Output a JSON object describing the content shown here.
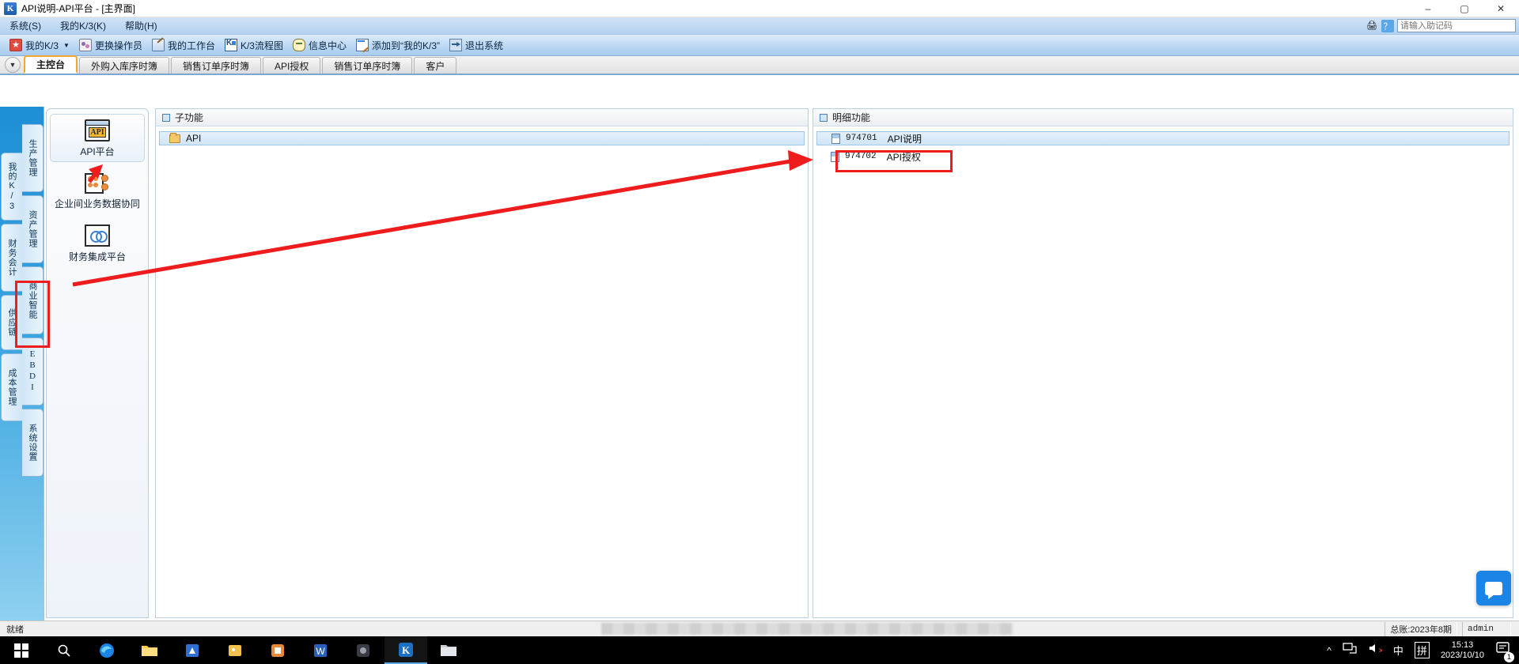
{
  "window": {
    "title": "API说明-API平台 - [主界面]",
    "app_icon": "k3-logo-icon",
    "minimize": "–",
    "maximize": "▢",
    "close": "✕"
  },
  "menubar": {
    "items": [
      {
        "label": "系统(S)",
        "name": "menu-system"
      },
      {
        "label": "我的K/3(K)",
        "name": "menu-my-k3"
      },
      {
        "label": "帮助(H)",
        "name": "menu-help"
      }
    ],
    "help_input_placeholder": "请输入助记码",
    "help_input_value": ""
  },
  "toolbar": {
    "buttons": [
      {
        "label": "我的K/3",
        "icon": "star-icon",
        "has_caret": true
      },
      {
        "label": "更换操作员",
        "icon": "switch-user-icon",
        "has_caret": false
      },
      {
        "label": "我的工作台",
        "icon": "workbench-icon",
        "has_caret": false
      },
      {
        "label": "K/3流程图",
        "icon": "flowchart-icon",
        "has_caret": false
      },
      {
        "label": "信息中心",
        "icon": "message-center-icon",
        "has_caret": false
      },
      {
        "label": "添加到“我的K/3”",
        "icon": "add-note-icon",
        "has_caret": false
      },
      {
        "label": "退出系统",
        "icon": "exit-icon",
        "has_caret": false
      }
    ]
  },
  "tabs": {
    "overflow_icon": "chevron-down-icon",
    "items": [
      {
        "label": "主控台",
        "active": true
      },
      {
        "label": "外购入库序时簿",
        "active": false
      },
      {
        "label": "销售订单序时簿",
        "active": false
      },
      {
        "label": "API授权",
        "active": false
      },
      {
        "label": "销售订单序时簿",
        "active": false
      },
      {
        "label": "客户",
        "active": false
      }
    ]
  },
  "vertical_nav": {
    "left_column": [
      {
        "label": "我的K/3"
      },
      {
        "label": "财务会计"
      },
      {
        "label": "供应链"
      },
      {
        "label": "成本管理"
      }
    ],
    "right_column": [
      {
        "label": "生产管理"
      },
      {
        "label": "资产管理"
      },
      {
        "label": "商业智能"
      },
      {
        "label": "EBDI"
      },
      {
        "label": "系统设置"
      }
    ]
  },
  "module_panel": {
    "items": [
      {
        "label": "API平台",
        "icon": "api-platform-icon",
        "selected": true
      },
      {
        "label": "企业间业务数据协同",
        "icon": "collaboration-icon",
        "selected": false
      },
      {
        "label": "财务集成平台",
        "icon": "finance-integration-icon",
        "selected": false
      }
    ]
  },
  "sub_function_panel": {
    "title": "子功能",
    "header_icon": "panel-square-icon",
    "rows": [
      {
        "label": "API",
        "icon": "folder-icon",
        "selected": true
      }
    ]
  },
  "detail_panel": {
    "title": "明细功能",
    "header_icon": "panel-square-icon",
    "rows": [
      {
        "code": "974701",
        "label": "API说明",
        "icon": "document-icon",
        "selected": true
      },
      {
        "code": "974702",
        "label": "API授权",
        "icon": "document-icon",
        "selected": false
      }
    ]
  },
  "annotations": {
    "color": "#ee1c1c",
    "boxes": [
      {
        "name": "ebdi-nav-highlight"
      },
      {
        "name": "api-authorize-row-highlight"
      }
    ],
    "arrow": {
      "name": "pointer-arrow",
      "from": "collaboration-icon",
      "to": "api-authorize-row"
    }
  },
  "statusbar": {
    "ready_text": "就绪",
    "ledger": "总账:2023年8期",
    "user": "admin"
  },
  "taskbar": {
    "start": "windows-start-icon",
    "items": [
      {
        "name": "search-icon"
      },
      {
        "name": "edge-browser-icon"
      },
      {
        "name": "file-explorer-icon"
      },
      {
        "name": "app-blue-icon"
      },
      {
        "name": "app-yellow-icon"
      },
      {
        "name": "app-orange-icon"
      },
      {
        "name": "office-icon"
      },
      {
        "name": "app-dark-icon"
      },
      {
        "name": "k3-app-icon"
      },
      {
        "name": "folder-app-icon"
      }
    ],
    "tray": {
      "chevron": "^",
      "network": "network-icon",
      "volume": "volume-muted-icon",
      "ime_lang": "中",
      "ime_mode": "拼",
      "time": "15:13",
      "date": "2023/10/10",
      "notifications_count": "1"
    }
  },
  "float_button": {
    "name": "chat-float-button",
    "icon": "chat-bubble-icon"
  }
}
